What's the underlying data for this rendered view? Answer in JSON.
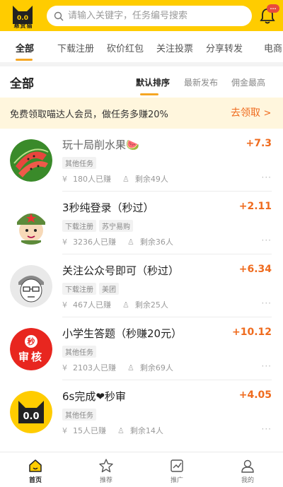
{
  "header": {
    "logo_text": "悬赏猫",
    "logo_eyes": "0.0",
    "search_placeholder": "请输入关键字，任务编号搜索",
    "notification_badge": "..."
  },
  "tabs": [
    "全部",
    "下载注册",
    "砍价红包",
    "关注投票",
    "分享转发",
    "电商"
  ],
  "sort": {
    "title": "全部",
    "options": [
      "默认排序",
      "最新发布",
      "佣金最高"
    ]
  },
  "promo": {
    "text": "免费领取喵达人会员，做任务多赚20%",
    "link": "去领取",
    "arrow": ">"
  },
  "tasks": [
    {
      "title": "玩十局削水果🍉",
      "reward": "+7.3",
      "tags": [
        "其他任务"
      ],
      "earned": "180人已赚",
      "remaining": "剩余49人",
      "avatar": "watermelon"
    },
    {
      "title": "3秒纯登录（秒过）",
      "reward": "+2.11",
      "tags": [
        "下载注册",
        "苏宁易购"
      ],
      "earned": "3236人已赚",
      "remaining": "剩余36人",
      "avatar": "soldier"
    },
    {
      "title": "关注公众号即可（秒过）",
      "reward": "+6.34",
      "tags": [
        "下载注册",
        "美团"
      ],
      "earned": "467人已赚",
      "remaining": "剩余25人",
      "avatar": "sketch-man"
    },
    {
      "title": "小学生答题（秒赚20元）",
      "reward": "+10.12",
      "tags": [
        "其他任务"
      ],
      "earned": "2103人已赚",
      "remaining": "剩余69人",
      "avatar": "audit-badge",
      "badge_top": "秒",
      "badge_bottom": "审核"
    },
    {
      "title": "6s完成❤秒审",
      "reward": "+4.05",
      "tags": [
        "其他任务"
      ],
      "earned": "15人已赚",
      "remaining": "剩余14人",
      "avatar": "cat-logo",
      "cat_eyes": "0.0"
    }
  ],
  "bottom_nav": [
    {
      "label": "首页",
      "icon": "home-icon",
      "active": true
    },
    {
      "label": "推荐",
      "icon": "star-icon",
      "active": false
    },
    {
      "label": "推广",
      "icon": "chart-icon",
      "active": false
    },
    {
      "label": "我的",
      "icon": "user-icon",
      "active": false
    }
  ],
  "colors": {
    "brand_yellow": "#ffcc00",
    "accent_orange": "#ef6b1e",
    "tab_underline": "#f5a623",
    "promo_bg": "#fff6dd"
  },
  "icons": {
    "meta_earned": "¥",
    "meta_remaining": "♙",
    "more": "···"
  }
}
